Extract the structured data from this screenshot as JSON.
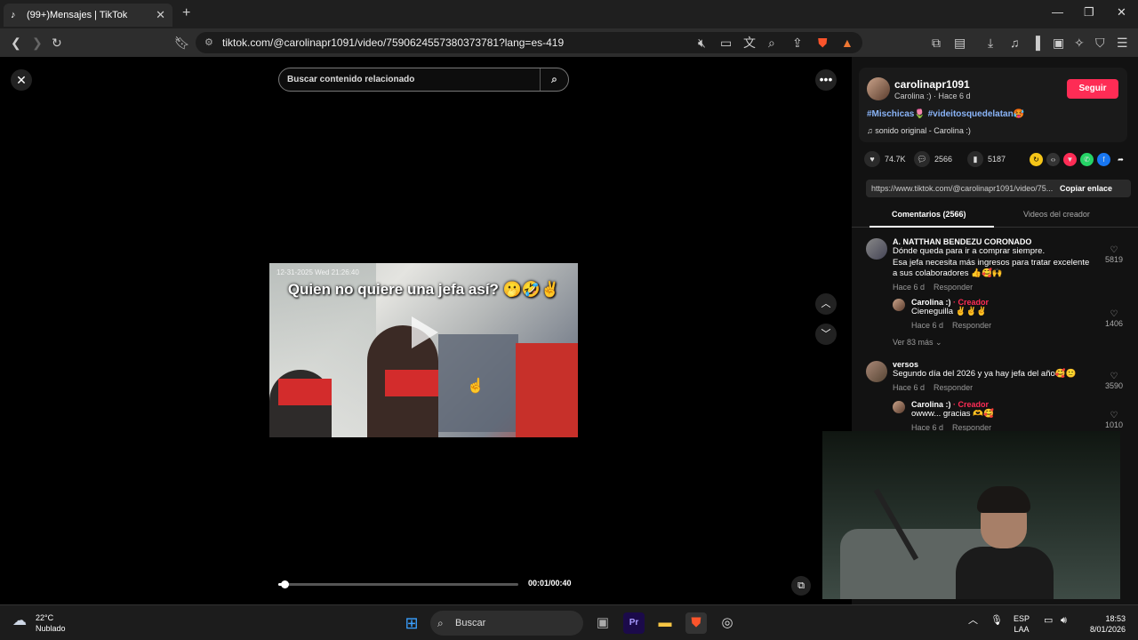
{
  "browser": {
    "tab_title": "(99+)Mensajes | TikTok",
    "url": "tiktok.com/@carolinapr1091/video/7590624557380373781?lang=es-419"
  },
  "search": {
    "placeholder": "Buscar contenido relacionado"
  },
  "video": {
    "caption": "Quien no quiere una jefa así? 🫢🤣✌️",
    "overlay_timestamp": "12-31-2025 Wed 21:26:40",
    "time": "00:01/00:40",
    "progress": 0.025
  },
  "author": {
    "username": "carolinapr1091",
    "subtitle": "Carolina :) · Hace 6 d",
    "follow_label": "Seguir",
    "tags": "#Mischicas🌷 #videitosquedelatan🥵",
    "sound": "sonido original - Carolina :)"
  },
  "actions": {
    "likes": "74.7K",
    "comments": "2566",
    "saves": "5187"
  },
  "link": {
    "url": "https://www.tiktok.com/@carolinapr1091/video/75...",
    "copy_label": "Copiar enlace"
  },
  "tabs": {
    "comments": "Comentarios (2566)",
    "creator_videos": "Videos del creador"
  },
  "comments": [
    {
      "name": "A. NATTHAN BENDEZU CORONADO",
      "text1": "Dónde queda para ir a comprar siempre.",
      "text2": "Esa jefa necesita más ingresos para tratar excelente",
      "text3": "a sus colaboradores 👍🥰🙌",
      "meta": "Hace 6 d",
      "reply": "Responder",
      "likes": "5819",
      "reply_name": "Carolina :)",
      "reply_badge": " · Creador",
      "reply_text": "Cieneguilla ✌️✌️✌️",
      "reply_meta": "Hace 6 d",
      "reply_reply": "Responder",
      "reply_likes": "1406",
      "more": "Ver 83 más ⌄"
    },
    {
      "name": "versos",
      "text1": "Segundo día del 2026 y ya hay jefa del año🥰🙂",
      "meta": "Hace 6 d",
      "reply": "Responder",
      "likes": "3590",
      "reply_name": "Carolina :)",
      "reply_badge": " · Creador",
      "reply_text": "owww... gracias 🫶🥰",
      "reply_meta": "Hace 6 d",
      "reply_reply": "Responder",
      "reply_likes": "1010"
    }
  ],
  "taskbar": {
    "temp": "22°C",
    "weather": "Nublado",
    "search": "Buscar",
    "lang1": "ESP",
    "lang2": "LAA",
    "time": "18:53",
    "date": "8/01/2026"
  },
  "icons": {
    "close": "close-icon",
    "more": "more-icon",
    "heart": "heart-icon",
    "comment": "comment-icon",
    "bookmark": "bookmark-icon"
  }
}
